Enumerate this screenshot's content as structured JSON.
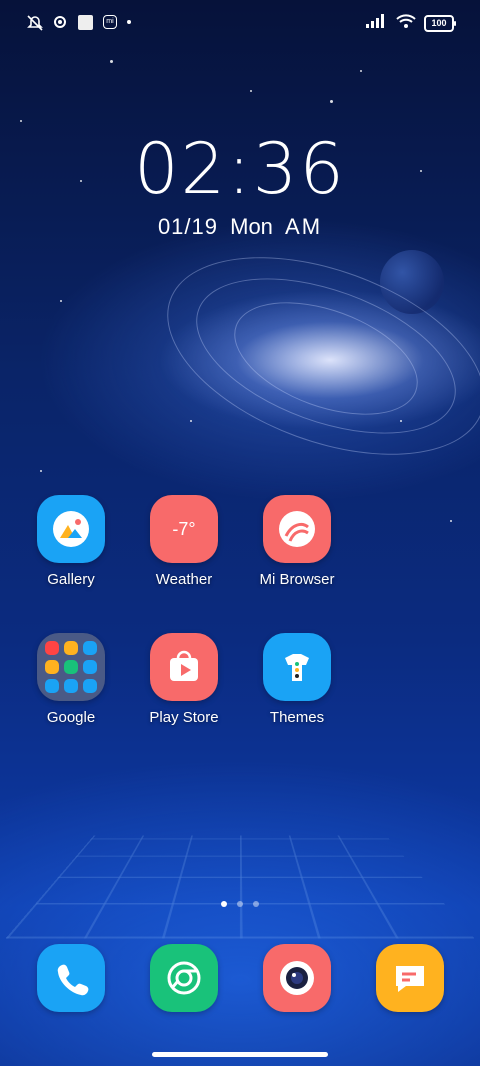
{
  "status_bar": {
    "left_icons": [
      "mute-icon",
      "settings-icon",
      "square-icon",
      "mi-icon",
      "dot-icon"
    ],
    "right_icons": [
      "signal-icon",
      "wifi-icon",
      "battery-icon"
    ],
    "battery": "100"
  },
  "lock": {
    "time": "02:36",
    "date": "01/19",
    "weekday": "Mon",
    "ampm": "AM"
  },
  "apps": [
    {
      "label": "Gallery",
      "icon": "gallery-icon",
      "color": "#1aa3f5"
    },
    {
      "label": "Weather",
      "icon": "weather-icon",
      "color": "#f86a6a",
      "text": "-7°"
    },
    {
      "label": "Mi Browser",
      "icon": "browser-icon",
      "color": "#f86a6a"
    },
    {
      "label": "Google",
      "icon": "folder-icon",
      "color": "#4a5a86"
    },
    {
      "label": "Play Store",
      "icon": "play-store-icon",
      "color": "#f86a6a"
    },
    {
      "label": "Themes",
      "icon": "themes-icon",
      "color": "#1aa3f5"
    }
  ],
  "dock": [
    {
      "icon": "phone-icon",
      "color": "#1aa3f5"
    },
    {
      "icon": "chrome-icon",
      "color": "#19c27a"
    },
    {
      "icon": "camera-icon",
      "color": "#f86a6a"
    },
    {
      "icon": "messages-icon",
      "color": "#ffb21f"
    }
  ],
  "page_indicator": {
    "count": 3,
    "active": 1
  }
}
